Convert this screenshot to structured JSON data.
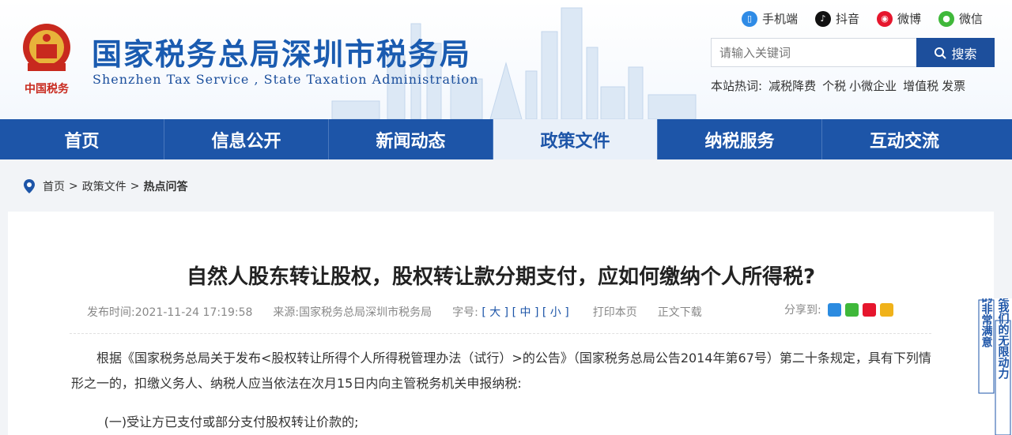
{
  "header": {
    "title": "国家税务总局深圳市税务局",
    "subtitle": "Shenzhen Tax Service , State Taxation Administration",
    "emblem_text": "中国税务"
  },
  "social": [
    {
      "label": "手机端",
      "icon": "mobile-icon",
      "color": "#2f8be6"
    },
    {
      "label": "抖音",
      "icon": "douyin-icon",
      "color": "#111111"
    },
    {
      "label": "微博",
      "icon": "weibo-icon",
      "color": "#e6162d"
    },
    {
      "label": "微信",
      "icon": "wechat-icon",
      "color": "#3fb83a"
    }
  ],
  "search": {
    "placeholder": "请输入关键词",
    "button_label": "搜索"
  },
  "hotwords": {
    "label": "本站热词:",
    "items": [
      "减税降费",
      "个税",
      "小微企业",
      "增值税",
      "发票"
    ]
  },
  "nav": {
    "items": [
      "首页",
      "信息公开",
      "新闻动态",
      "政策文件",
      "纳税服务",
      "互动交流"
    ],
    "active": "政策文件"
  },
  "breadcrumb": {
    "items": [
      "首页",
      "政策文件",
      "热点问答"
    ],
    "separator": ">"
  },
  "article": {
    "title": "自然人股东转让股权，股权转让款分期支付，应如何缴纳个人所得税?",
    "publish_label": "发布时间:",
    "publish_time": "2021-11-24 17:19:58",
    "source_label": "来源:",
    "source": "国家税务总局深圳市税务局",
    "font_label": "字号:",
    "font_sizes": [
      "[ 大 ]",
      "[ 中 ]",
      "[ 小 ]"
    ],
    "print": "打印本页",
    "download": "正文下载",
    "share_label": "分享到:",
    "paragraphs": [
      "根据《国家税务总局关于发布<股权转让所得个人所得税管理办法（试行）>的公告》（国家税务总局公告2014年第67号）第二十条规定，具有下列情形之一的，扣缴义务人、纳税人应当依法在次月15日内向主管税务机关申报纳税:",
      "(一)受让方已支付或部分支付股权转让价款的;"
    ]
  },
  "side_banner": {
    "col1": "您的非常满意",
    "col2": "是我们的无限动力"
  },
  "colors": {
    "brand_blue": "#1d55a8",
    "nav_active_bg": "#e9f0f9"
  }
}
